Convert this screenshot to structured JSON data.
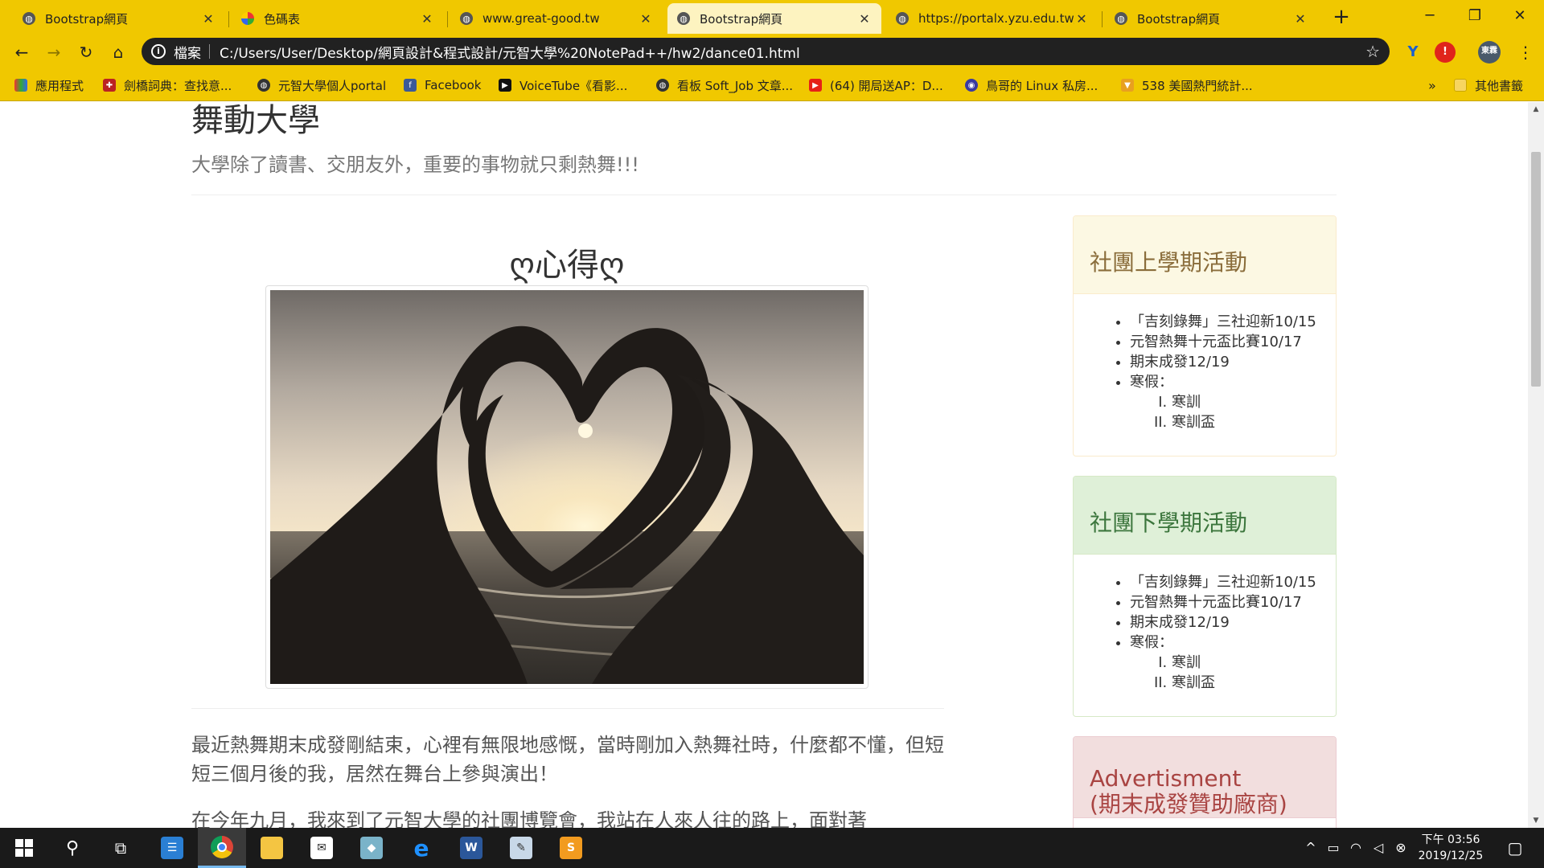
{
  "browser": {
    "tabs": [
      {
        "title": "Bootstrap網頁",
        "icon": "globe-icon"
      },
      {
        "title": "色碼表",
        "icon": "color-palette-icon"
      },
      {
        "title": "www.great-good.tw",
        "icon": "globe-icon"
      },
      {
        "title": "Bootstrap網頁",
        "icon": "globe-icon",
        "active": true
      },
      {
        "title": "https://portalx.yzu.edu.tw/",
        "icon": "globe-icon"
      },
      {
        "title": "Bootstrap網頁",
        "icon": "globe-icon"
      }
    ],
    "address": {
      "scheme_label": "檔案",
      "url": "C:/Users/User/Desktop/網頁設計&程式設計/元智大學%20NotePad++/hw2/dance01.html"
    },
    "profile_avatar": "東霖",
    "bookmarks": [
      {
        "label": "應用程式",
        "icon": "apps-grid-icon"
      },
      {
        "label": "劍橋詞典：查找意...",
        "icon": "cambridge-shield-icon"
      },
      {
        "label": "元智大學個人portal",
        "icon": "globe-icon"
      },
      {
        "label": "Facebook",
        "icon": "facebook-icon"
      },
      {
        "label": "VoiceTube《看影...",
        "icon": "voicetube-icon"
      },
      {
        "label": "看板 Soft_Job 文章...",
        "icon": "globe-icon"
      },
      {
        "label": "(64) 開局送AP：D...",
        "icon": "youtube-icon"
      },
      {
        "label": "鳥哥的 Linux 私房...",
        "icon": "linux-bird-icon"
      },
      {
        "label": "538 美國熱門統計...",
        "icon": "fivethirtyeight-icon"
      }
    ],
    "overflow_chevron": "»",
    "other_bookmarks": "其他書籤"
  },
  "page": {
    "title": "舞動大學",
    "subtitle": "大學除了讀書、交朋友外，重要的事物就只剩熱舞!!!",
    "section_heading": "ღ心得ღ",
    "paragraphs": [
      "最近熱舞期末成發剛結束，心裡有無限地感慨，當時剛加入熱舞社時，什麼都不懂，但短短三個月後的我，居然在舞台上參與演出！",
      "在今年九月，我來到了元智大學的社團博覽會，我站在人來人往的路上，面對著"
    ],
    "panels": [
      {
        "title": "社團上學期活動",
        "items": [
          "「吉刻錄舞」三社迎新10/15",
          "元智熱舞十元盃比賽10/17",
          "期末成發12/19",
          "寒假："
        ],
        "subitems": [
          "寒訓",
          "寒訓盃"
        ]
      },
      {
        "title": "社團下學期活動",
        "items": [
          "「吉刻錄舞」三社迎新10/15",
          "元智熱舞十元盃比賽10/17",
          "期末成發12/19",
          "寒假："
        ],
        "subitems": [
          "寒訓",
          "寒訓盃"
        ]
      },
      {
        "title_line1": "Advertisment",
        "title_line2": "(期末成發贊助廠商)"
      }
    ]
  },
  "taskbar": {
    "clock_time": "下午 03:56",
    "clock_date": "2019/12/25"
  }
}
